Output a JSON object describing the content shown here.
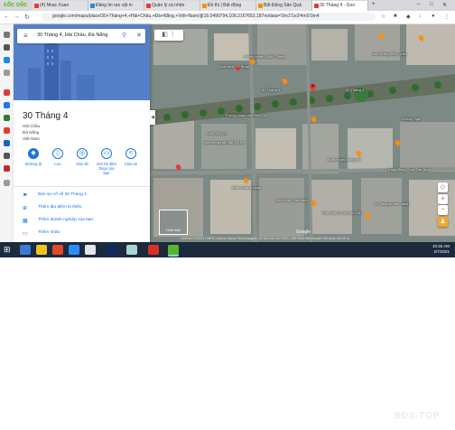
{
  "browser": {
    "brand": "cốc cốc",
    "tabs": [
      {
        "label": "(4) Nhac Xuan",
        "color": "#e53935"
      },
      {
        "label": "Đăng tin rao vặt m",
        "color": "#1e88e5"
      },
      {
        "label": "Quản lý cá nhân",
        "color": "#e53935"
      },
      {
        "label": "Đồ thị | Bất động",
        "color": "#fb8c00"
      },
      {
        "label": "Bất Động Sản Quả",
        "color": "#fb8c00"
      },
      {
        "label": "30 Tháng 4 - Goo",
        "color": "#e53935"
      }
    ],
    "url": "google.com/maps/place/30+Tháng+4,+Hải+Châu,+Đà+Nẵng,+Việt+Nam/@16.0490794,108.2167653,187m/data=!3m1!1e3!4m5!3m4"
  },
  "panel": {
    "search_value": "30 Tháng 4, Hải Châu, Đà Nẵng",
    "title": "30 Tháng 4",
    "address_lines": [
      "Hải Châu",
      "Đà Nẵng",
      "Việt Nam"
    ],
    "actions": [
      {
        "icon": "directions-icon",
        "glyph": "◆",
        "label": "Đường đi"
      },
      {
        "icon": "bookmark-icon",
        "glyph": "▯",
        "label": "Lưu"
      },
      {
        "icon": "nearby-icon",
        "glyph": "◎",
        "label": "Gần đó"
      },
      {
        "icon": "phone-icon",
        "glyph": "▭",
        "label": "Gửi tới điện thoại của bạn"
      },
      {
        "icon": "share-icon",
        "glyph": "<",
        "label": "Chia sẻ"
      }
    ],
    "links": [
      {
        "icon": "flag-icon",
        "glyph": "⚑",
        "label": "Báo sự cố về 30 Tháng 4"
      },
      {
        "icon": "add-place-icon",
        "glyph": "⊕",
        "label": "Thêm địa điểm bị thiếu"
      },
      {
        "icon": "business-icon",
        "glyph": "▦",
        "label": "Thêm doanh nghiệp của bạn"
      },
      {
        "icon": "label-icon",
        "glyph": "▭",
        "label": "Thêm nhãn"
      }
    ]
  },
  "map": {
    "pin_color": "#e53935",
    "labels": [
      "Anh Minh Tú Shop",
      "Phòng khám Quốc Thắng",
      "30 Tháng 4",
      "Trường Mầm non Sơn Ca",
      "Anh Cửu Vũ",
      "Nhà Hàng Hải Sản Gà Bé",
      "30 Tháng 4",
      "Luxury Spa",
      "Khách sạn Đông Hải",
      "Trang Bông Tươi Tân Sơn",
      "Điện thoại di động",
      "GoodChef Viet Nam",
      "Phụ Kiện Ô Tô Vĩnh Tân",
      "NT Beauty Hair Salon",
      "Hai Dường Bến Quán"
    ],
    "copyright": "Hình ảnh ©2021 CNES / Airbus, Maxar Technologies, Dữ liệu bản đồ ©2021  Việt Nam  Điều khoản  Gửi phản hồi  20 m",
    "imagery_label": "Hình ảnh"
  },
  "taskbar": {
    "time": "10:45 AM",
    "date": "2/7/2021"
  },
  "watermark": "BĐS.TOP"
}
